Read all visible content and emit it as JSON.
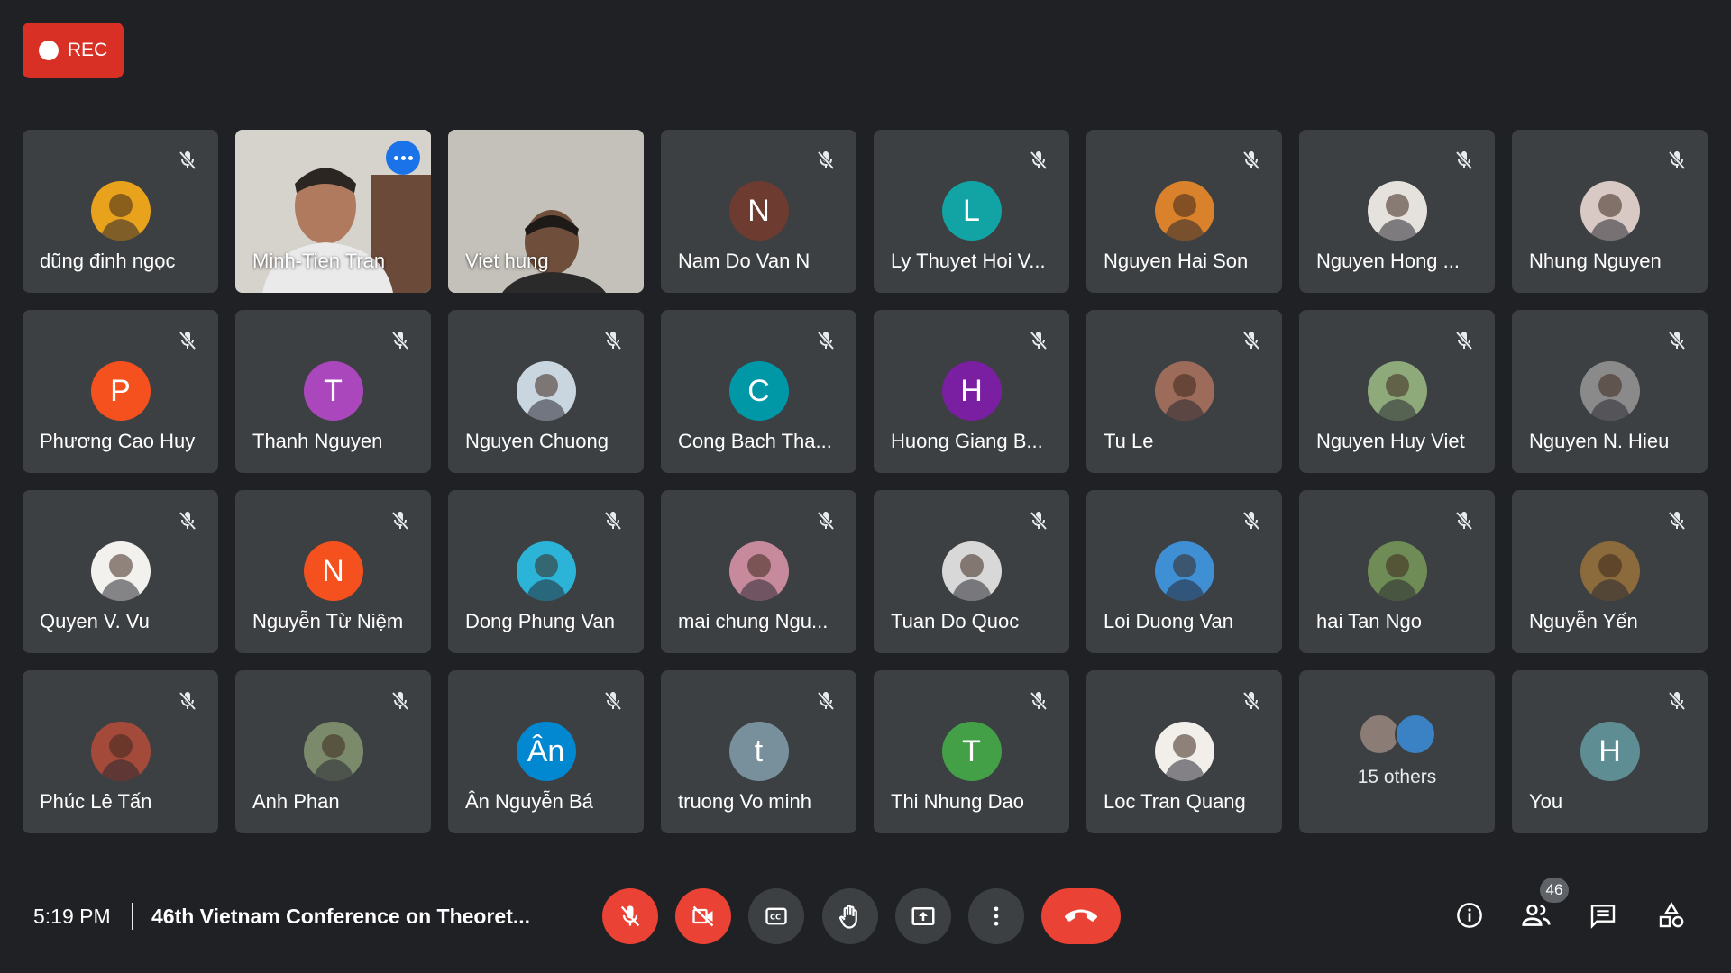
{
  "recording": {
    "label": "REC"
  },
  "participants": [
    {
      "name": "dũng đinh ngọc",
      "type": "photo",
      "color": "#e9a21c"
    },
    {
      "name": "Minh-Tien Tran",
      "type": "video",
      "active": true
    },
    {
      "name": "Viet hung",
      "type": "video2"
    },
    {
      "name": "Nam Do Van N",
      "type": "initial",
      "initial": "N",
      "color": "#6d3b2f"
    },
    {
      "name": "Ly Thuyet Hoi V...",
      "type": "initial",
      "initial": "L",
      "color": "#12a4a4"
    },
    {
      "name": "Nguyen Hai Son",
      "type": "photo",
      "color": "#d9822b"
    },
    {
      "name": "Nguyen Hong ...",
      "type": "photo",
      "color": "#e5e1dc"
    },
    {
      "name": "Nhung Nguyen",
      "type": "photo",
      "color": "#d8c9c4"
    },
    {
      "name": "Phương Cao Huy",
      "type": "initial",
      "initial": "P",
      "color": "#f4511e"
    },
    {
      "name": "Thanh Nguyen",
      "type": "initial",
      "initial": "T",
      "color": "#ab47bc"
    },
    {
      "name": "Nguyen Chuong",
      "type": "photo",
      "color": "#c9d6e0"
    },
    {
      "name": "Cong Bach Tha...",
      "type": "initial",
      "initial": "C",
      "color": "#0097a7"
    },
    {
      "name": "Huong Giang B...",
      "type": "initial",
      "initial": "H",
      "color": "#7b1fa2"
    },
    {
      "name": "Tu Le",
      "type": "photo",
      "color": "#9c6b5a"
    },
    {
      "name": "Nguyen Huy Viet",
      "type": "photo",
      "color": "#8ea97a"
    },
    {
      "name": "Nguyen N. Hieu",
      "type": "photo",
      "color": "#8a8a8a"
    },
    {
      "name": "Quyen V. Vu",
      "type": "photo",
      "color": "#f3f1ee"
    },
    {
      "name": "Nguyễn Từ Niệm",
      "type": "initial",
      "initial": "N",
      "color": "#f4511e"
    },
    {
      "name": "Dong Phung Van",
      "type": "photo",
      "color": "#2cb3d8"
    },
    {
      "name": "mai chung Ngu...",
      "type": "photo",
      "color": "#c78a9c"
    },
    {
      "name": "Tuan Do Quoc",
      "type": "photo",
      "color": "#d8d8d8"
    },
    {
      "name": "Loi Duong Van",
      "type": "photo",
      "color": "#3f8fd4"
    },
    {
      "name": "hai Tan Ngo",
      "type": "photo",
      "color": "#6f8c56"
    },
    {
      "name": "Nguyễn Yến",
      "type": "photo",
      "color": "#8b6a3c"
    },
    {
      "name": "Phúc Lê Tấn",
      "type": "photo",
      "color": "#a34a3a"
    },
    {
      "name": "Anh Phan",
      "type": "photo",
      "color": "#7b8a6b"
    },
    {
      "name": "Ân Nguyễn Bá",
      "type": "initial",
      "initial": "Ân",
      "color": "#0288d1"
    },
    {
      "name": "truong Vo minh",
      "type": "initial",
      "initial": "t",
      "color": "#78909c"
    },
    {
      "name": "Thi Nhung Dao",
      "type": "initial",
      "initial": "T",
      "color": "#43a047"
    },
    {
      "name": "Loc Tran Quang",
      "type": "photo",
      "color": "#f2eeea"
    },
    {
      "name": "15 others",
      "type": "others"
    },
    {
      "name": "You",
      "type": "initial",
      "initial": "H",
      "color": "#5f8d94"
    }
  ],
  "bottom_bar": {
    "time": "5:19 PM",
    "meeting_title": "46th Vietnam Conference on Theoret...",
    "participant_count": "46"
  },
  "icons": {
    "mic_off": "mic-off-icon",
    "camera_off": "camera-off-icon",
    "captions": "captions-icon",
    "raise_hand": "raise-hand-icon",
    "present": "present-screen-icon",
    "more": "more-options-icon",
    "end_call": "end-call-icon",
    "info": "info-icon",
    "people": "people-icon",
    "chat": "chat-icon",
    "activities": "activities-icon"
  }
}
